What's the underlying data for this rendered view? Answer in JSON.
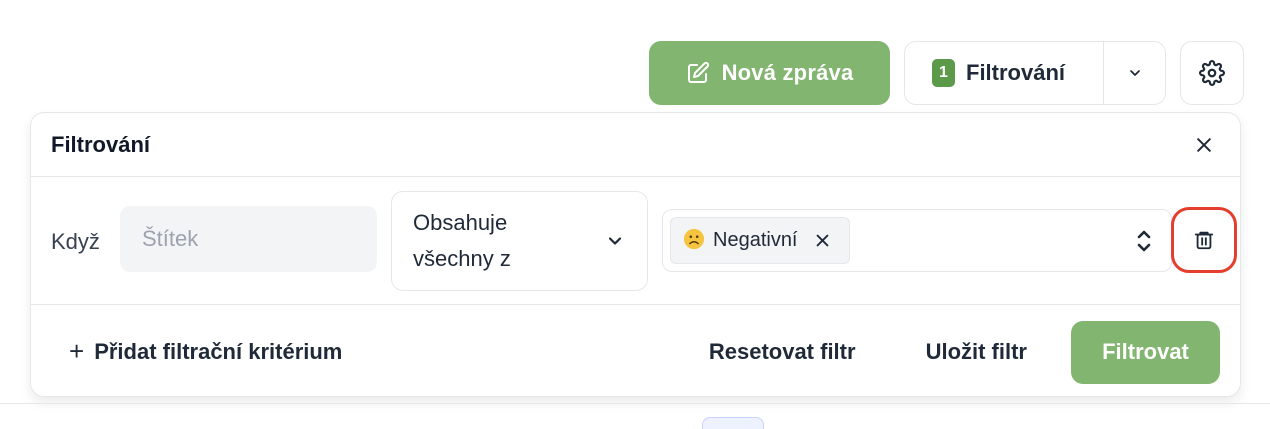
{
  "toolbar": {
    "new_message_label": "Nová zpráva",
    "filter_label": "Filtrování",
    "filter_count": "1"
  },
  "panel": {
    "title": "Filtrování",
    "criterion": {
      "when_label": "Když",
      "field_placeholder": "Štítek",
      "operator": "Obsahuje všechny z",
      "value_chip": {
        "emoji": "☹",
        "label": "Negativní"
      }
    },
    "footer": {
      "add_criterion_label": "Přidat filtrační kritérium",
      "reset_label": "Resetovat filtr",
      "save_label": "Uložit filtr",
      "apply_label": "Filtrovat"
    }
  },
  "colors": {
    "primary": "#82b56f",
    "badge": "#5c9a4a",
    "danger_outline": "#e53e2e"
  }
}
